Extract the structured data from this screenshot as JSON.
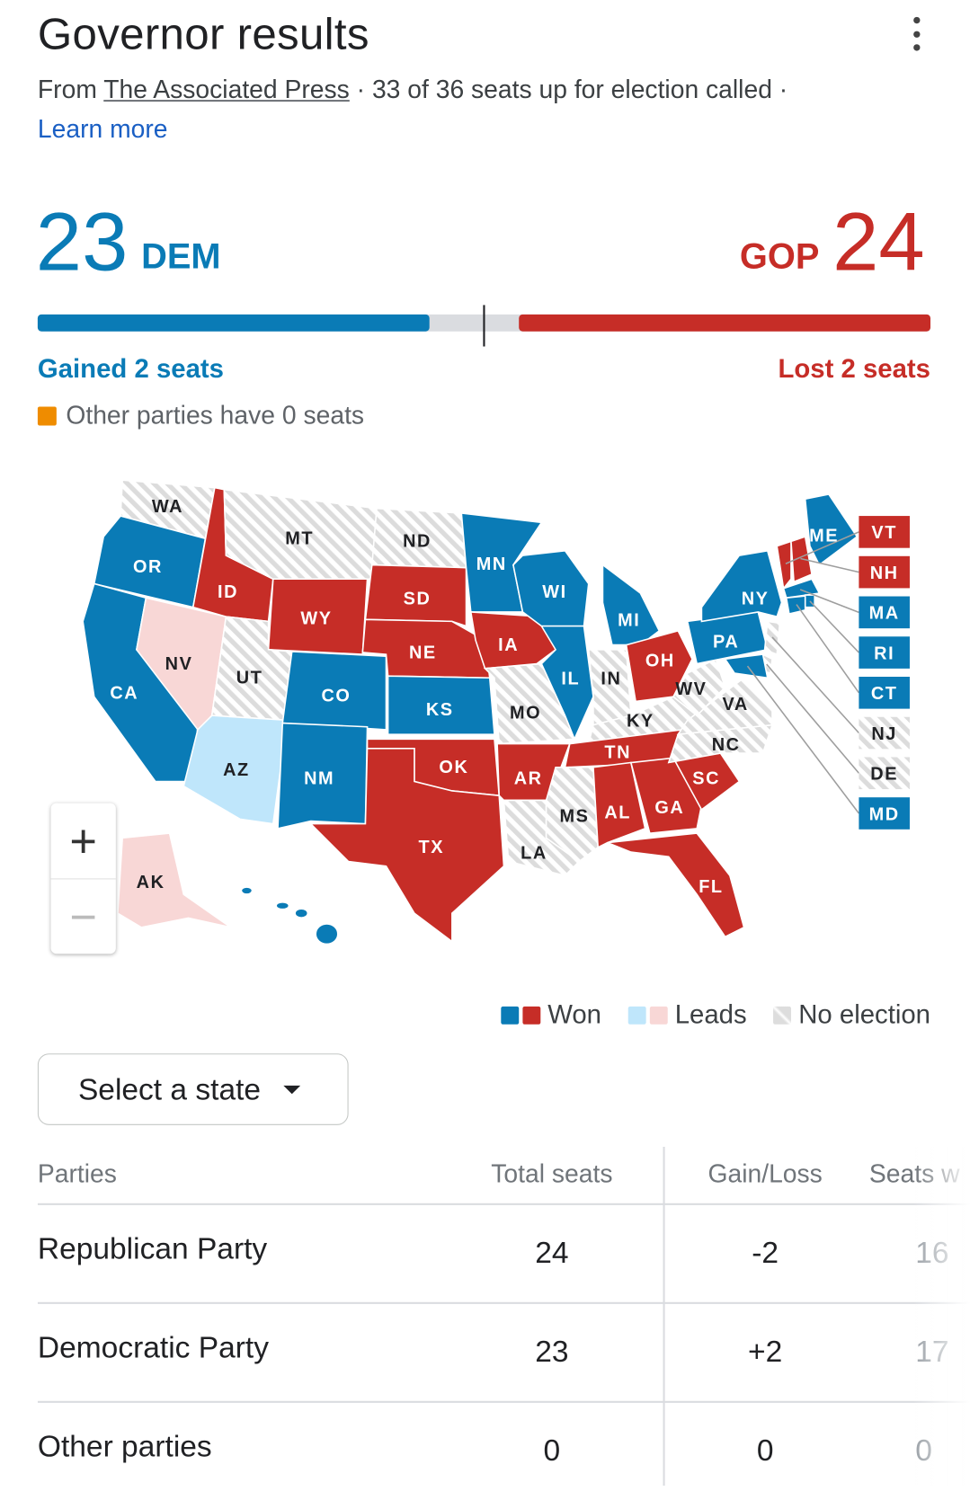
{
  "header": {
    "title": "Governor results",
    "menu_icon": "more-vert-icon",
    "from": "From ",
    "source": "The Associated Press",
    "summary": " · 33 of 36 seats up for election called · ",
    "learn_more": "Learn more"
  },
  "tally": {
    "dem_count": "23",
    "dem_label": "DEM",
    "gop_count": "24",
    "gop_label": "GOP",
    "dem_seats": 23,
    "gop_seats": 24,
    "total_seats": 50,
    "dem_change": "Gained 2 seats",
    "gop_change": "Lost 2 seats",
    "other_text": "Other parties have 0 seats"
  },
  "colors": {
    "dem": "#0a7bb6",
    "gop": "#c62d27",
    "dem_lead": "#bfe6fb",
    "gop_lead": "#f8d7d6",
    "other": "#ef8c00",
    "none": "#e6e6e6"
  },
  "map": {
    "states": [
      {
        "abbr": "WA",
        "status": "none"
      },
      {
        "abbr": "OR",
        "status": "dem"
      },
      {
        "abbr": "CA",
        "status": "dem"
      },
      {
        "abbr": "NV",
        "status": "gop_lead"
      },
      {
        "abbr": "ID",
        "status": "gop"
      },
      {
        "abbr": "MT",
        "status": "none"
      },
      {
        "abbr": "WY",
        "status": "gop"
      },
      {
        "abbr": "UT",
        "status": "none"
      },
      {
        "abbr": "AZ",
        "status": "dem_lead"
      },
      {
        "abbr": "CO",
        "status": "dem"
      },
      {
        "abbr": "NM",
        "status": "dem"
      },
      {
        "abbr": "ND",
        "status": "none"
      },
      {
        "abbr": "SD",
        "status": "gop"
      },
      {
        "abbr": "NE",
        "status": "gop"
      },
      {
        "abbr": "KS",
        "status": "dem"
      },
      {
        "abbr": "OK",
        "status": "gop"
      },
      {
        "abbr": "TX",
        "status": "gop"
      },
      {
        "abbr": "MN",
        "status": "dem"
      },
      {
        "abbr": "IA",
        "status": "gop"
      },
      {
        "abbr": "MO",
        "status": "none"
      },
      {
        "abbr": "AR",
        "status": "gop"
      },
      {
        "abbr": "LA",
        "status": "none"
      },
      {
        "abbr": "WI",
        "status": "dem"
      },
      {
        "abbr": "IL",
        "status": "dem"
      },
      {
        "abbr": "MI",
        "status": "dem"
      },
      {
        "abbr": "IN",
        "status": "none"
      },
      {
        "abbr": "OH",
        "status": "gop"
      },
      {
        "abbr": "KY",
        "status": "none"
      },
      {
        "abbr": "TN",
        "status": "gop"
      },
      {
        "abbr": "MS",
        "status": "none"
      },
      {
        "abbr": "AL",
        "status": "gop"
      },
      {
        "abbr": "GA",
        "status": "gop"
      },
      {
        "abbr": "FL",
        "status": "gop"
      },
      {
        "abbr": "SC",
        "status": "gop"
      },
      {
        "abbr": "NC",
        "status": "none"
      },
      {
        "abbr": "VA",
        "status": "none"
      },
      {
        "abbr": "WV",
        "status": "none"
      },
      {
        "abbr": "PA",
        "status": "dem"
      },
      {
        "abbr": "NY",
        "status": "dem"
      },
      {
        "abbr": "ME",
        "status": "dem"
      },
      {
        "abbr": "VT",
        "status": "gop"
      },
      {
        "abbr": "NH",
        "status": "gop"
      },
      {
        "abbr": "MA",
        "status": "dem"
      },
      {
        "abbr": "RI",
        "status": "dem"
      },
      {
        "abbr": "CT",
        "status": "dem"
      },
      {
        "abbr": "NJ",
        "status": "none"
      },
      {
        "abbr": "DE",
        "status": "none"
      },
      {
        "abbr": "MD",
        "status": "dem"
      },
      {
        "abbr": "AK",
        "status": "gop_lead"
      },
      {
        "abbr": "HI",
        "status": "dem"
      }
    ],
    "callouts": [
      "VT",
      "NH",
      "MA",
      "RI",
      "CT",
      "NJ",
      "DE",
      "MD"
    ],
    "zoom_in": "+",
    "zoom_out": "−"
  },
  "legend": {
    "won": "Won",
    "leads": "Leads",
    "none": "No election"
  },
  "select": {
    "label": "Select a state",
    "icon": "arrow-drop-down-icon"
  },
  "table": {
    "headers": [
      "Parties",
      "Total seats",
      "Gain/Loss",
      "Seats w"
    ],
    "rows": [
      [
        "Republican Party",
        "24",
        "-2",
        "16"
      ],
      [
        "Democratic Party",
        "23",
        "+2",
        "17"
      ],
      [
        "Other parties",
        "0",
        "0",
        "0"
      ]
    ]
  }
}
